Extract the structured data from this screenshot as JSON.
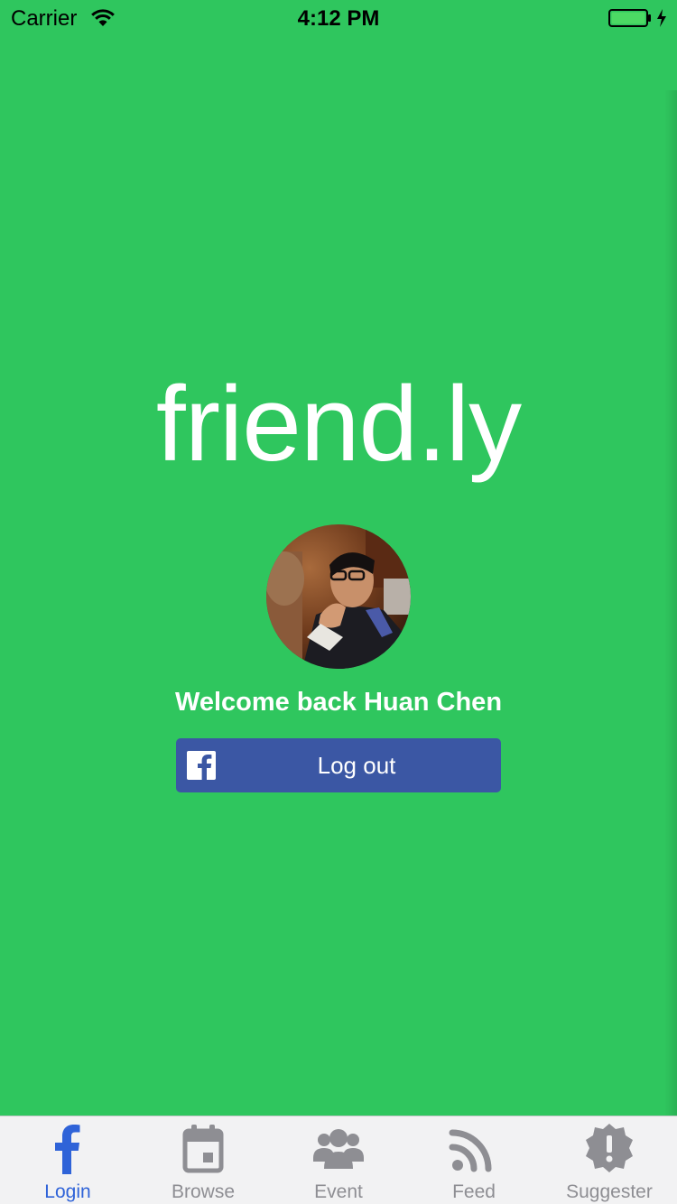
{
  "status_bar": {
    "carrier": "Carrier",
    "time": "4:12 PM",
    "icons": [
      "wifi-icon",
      "battery-icon",
      "charging-bolt-icon"
    ]
  },
  "app": {
    "logo": "friend.ly",
    "welcome": "Welcome back Huan Chen",
    "logout_label": "Log out",
    "background_color": "#2fc65e",
    "button_color": "#3b57a4"
  },
  "tab_bar": {
    "active_color": "#2f63d8",
    "inactive_color": "#8e8e93",
    "tabs": [
      {
        "label": "Login",
        "icon": "facebook-icon",
        "active": true
      },
      {
        "label": "Browse",
        "icon": "calendar-icon",
        "active": false
      },
      {
        "label": "Event",
        "icon": "group-icon",
        "active": false
      },
      {
        "label": "Feed",
        "icon": "rss-icon",
        "active": false
      },
      {
        "label": "Suggester",
        "icon": "alert-badge-icon",
        "active": false
      }
    ]
  }
}
